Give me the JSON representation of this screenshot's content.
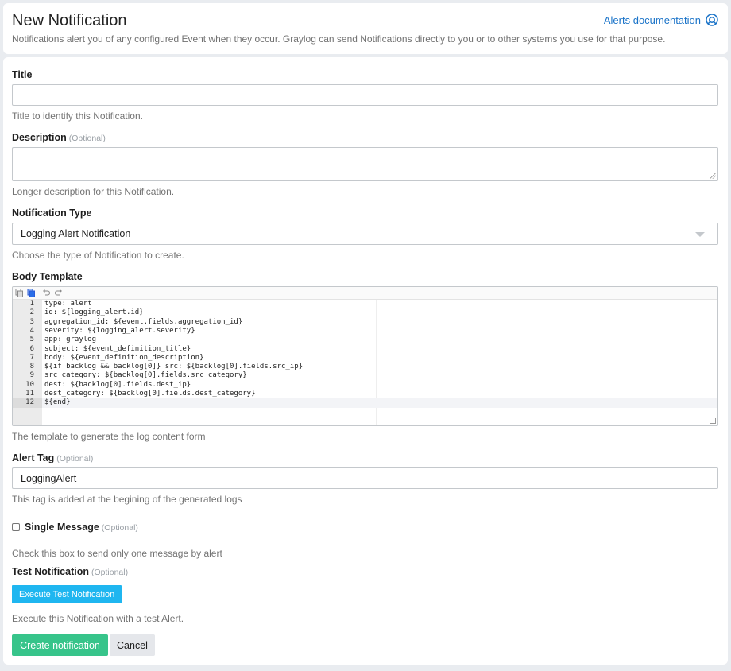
{
  "header": {
    "title": "New Notification",
    "subtitle": "Notifications alert you of any configured Event when they occur. Graylog can send Notifications directly to you or to other systems you use for that purpose.",
    "doc_link": "Alerts documentation",
    "doc_icon": "lifebuoy-icon"
  },
  "form": {
    "title": {
      "label": "Title",
      "value": "",
      "help": "Title to identify this Notification."
    },
    "description": {
      "label": "Description",
      "optional": "(Optional)",
      "value": "",
      "help": "Longer description for this Notification."
    },
    "notification_type": {
      "label": "Notification Type",
      "selected": "Logging Alert Notification",
      "help": "Choose the type of Notification to create."
    },
    "body_template": {
      "label": "Body Template",
      "toolbar_icons": [
        "copy-icon",
        "paste-icon",
        "undo-icon",
        "redo-icon"
      ],
      "lines": [
        "type: alert",
        "id: ${logging_alert.id}",
        "aggregation_id: ${event.fields.aggregation_id}",
        "severity: ${logging_alert.severity}",
        "app: graylog",
        "subject: ${event_definition_title}",
        "body: ${event_definition_description}",
        "${if backlog && backlog[0]} src: ${backlog[0].fields.src_ip}",
        "src_category: ${backlog[0].fields.src_category}",
        "dest: ${backlog[0].fields.dest_ip}",
        "dest_category: ${backlog[0].fields.dest_category}",
        "${end}"
      ],
      "line_numbers": [
        "1",
        "2",
        "3",
        "4",
        "5",
        "6",
        "7",
        "8",
        "9",
        "10",
        "11",
        "12"
      ],
      "active_line": 12,
      "help": "The template to generate the log content form"
    },
    "alert_tag": {
      "label": "Alert Tag",
      "optional": "(Optional)",
      "value": "LoggingAlert",
      "help": "This tag is added at the begining of the generated logs"
    },
    "single_message": {
      "label": "Single Message",
      "optional": "(Optional)",
      "checked": false,
      "help": "Check this box to send only one message by alert"
    },
    "test_notification": {
      "label": "Test Notification",
      "optional": "(Optional)",
      "button": "Execute Test Notification",
      "help": "Execute this Notification with a test Alert."
    }
  },
  "actions": {
    "create": "Create notification",
    "cancel": "Cancel"
  },
  "colors": {
    "accent_link": "#1a73c8",
    "test_button": "#1fb6f0",
    "create_button": "#37c48a",
    "cancel_button": "#e5e7eb",
    "background": "#e9ecf0"
  }
}
